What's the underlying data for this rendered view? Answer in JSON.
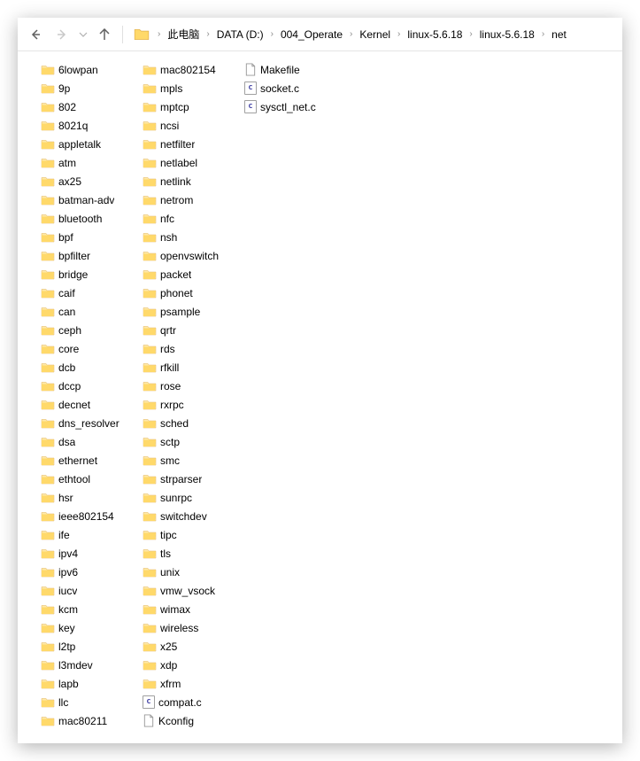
{
  "nav": {
    "back": "←",
    "forward": "→",
    "recent": "⌄",
    "up": "↑"
  },
  "breadcrumb": [
    {
      "label": "此电脑"
    },
    {
      "label": "DATA (D:)"
    },
    {
      "label": "004_Operate"
    },
    {
      "label": "Kernel"
    },
    {
      "label": "linux-5.6.18"
    },
    {
      "label": "linux-5.6.18"
    },
    {
      "label": "net"
    }
  ],
  "items": [
    {
      "name": "6lowpan",
      "type": "folder"
    },
    {
      "name": "9p",
      "type": "folder"
    },
    {
      "name": "802",
      "type": "folder"
    },
    {
      "name": "8021q",
      "type": "folder"
    },
    {
      "name": "appletalk",
      "type": "folder"
    },
    {
      "name": "atm",
      "type": "folder"
    },
    {
      "name": "ax25",
      "type": "folder"
    },
    {
      "name": "batman-adv",
      "type": "folder"
    },
    {
      "name": "bluetooth",
      "type": "folder"
    },
    {
      "name": "bpf",
      "type": "folder"
    },
    {
      "name": "bpfilter",
      "type": "folder"
    },
    {
      "name": "bridge",
      "type": "folder"
    },
    {
      "name": "caif",
      "type": "folder"
    },
    {
      "name": "can",
      "type": "folder"
    },
    {
      "name": "ceph",
      "type": "folder"
    },
    {
      "name": "core",
      "type": "folder"
    },
    {
      "name": "dcb",
      "type": "folder"
    },
    {
      "name": "dccp",
      "type": "folder"
    },
    {
      "name": "decnet",
      "type": "folder"
    },
    {
      "name": "dns_resolver",
      "type": "folder"
    },
    {
      "name": "dsa",
      "type": "folder"
    },
    {
      "name": "ethernet",
      "type": "folder"
    },
    {
      "name": "ethtool",
      "type": "folder"
    },
    {
      "name": "hsr",
      "type": "folder"
    },
    {
      "name": "ieee802154",
      "type": "folder"
    },
    {
      "name": "ife",
      "type": "folder"
    },
    {
      "name": "ipv4",
      "type": "folder"
    },
    {
      "name": "ipv6",
      "type": "folder"
    },
    {
      "name": "iucv",
      "type": "folder"
    },
    {
      "name": "kcm",
      "type": "folder"
    },
    {
      "name": "key",
      "type": "folder"
    },
    {
      "name": "l2tp",
      "type": "folder"
    },
    {
      "name": "l3mdev",
      "type": "folder"
    },
    {
      "name": "lapb",
      "type": "folder"
    },
    {
      "name": "llc",
      "type": "folder"
    },
    {
      "name": "mac80211",
      "type": "folder"
    },
    {
      "name": "mac802154",
      "type": "folder"
    },
    {
      "name": "mpls",
      "type": "folder"
    },
    {
      "name": "mptcp",
      "type": "folder"
    },
    {
      "name": "ncsi",
      "type": "folder"
    },
    {
      "name": "netfilter",
      "type": "folder"
    },
    {
      "name": "netlabel",
      "type": "folder"
    },
    {
      "name": "netlink",
      "type": "folder"
    },
    {
      "name": "netrom",
      "type": "folder"
    },
    {
      "name": "nfc",
      "type": "folder"
    },
    {
      "name": "nsh",
      "type": "folder"
    },
    {
      "name": "openvswitch",
      "type": "folder"
    },
    {
      "name": "packet",
      "type": "folder"
    },
    {
      "name": "phonet",
      "type": "folder"
    },
    {
      "name": "psample",
      "type": "folder"
    },
    {
      "name": "qrtr",
      "type": "folder"
    },
    {
      "name": "rds",
      "type": "folder"
    },
    {
      "name": "rfkill",
      "type": "folder"
    },
    {
      "name": "rose",
      "type": "folder"
    },
    {
      "name": "rxrpc",
      "type": "folder"
    },
    {
      "name": "sched",
      "type": "folder"
    },
    {
      "name": "sctp",
      "type": "folder"
    },
    {
      "name": "smc",
      "type": "folder"
    },
    {
      "name": "strparser",
      "type": "folder"
    },
    {
      "name": "sunrpc",
      "type": "folder"
    },
    {
      "name": "switchdev",
      "type": "folder"
    },
    {
      "name": "tipc",
      "type": "folder"
    },
    {
      "name": "tls",
      "type": "folder"
    },
    {
      "name": "unix",
      "type": "folder"
    },
    {
      "name": "vmw_vsock",
      "type": "folder"
    },
    {
      "name": "wimax",
      "type": "folder"
    },
    {
      "name": "wireless",
      "type": "folder"
    },
    {
      "name": "x25",
      "type": "folder"
    },
    {
      "name": "xdp",
      "type": "folder"
    },
    {
      "name": "xfrm",
      "type": "folder"
    },
    {
      "name": "compat.c",
      "type": "c"
    },
    {
      "name": "Kconfig",
      "type": "blank"
    },
    {
      "name": "Makefile",
      "type": "blank"
    },
    {
      "name": "socket.c",
      "type": "c"
    },
    {
      "name": "sysctl_net.c",
      "type": "c"
    }
  ]
}
